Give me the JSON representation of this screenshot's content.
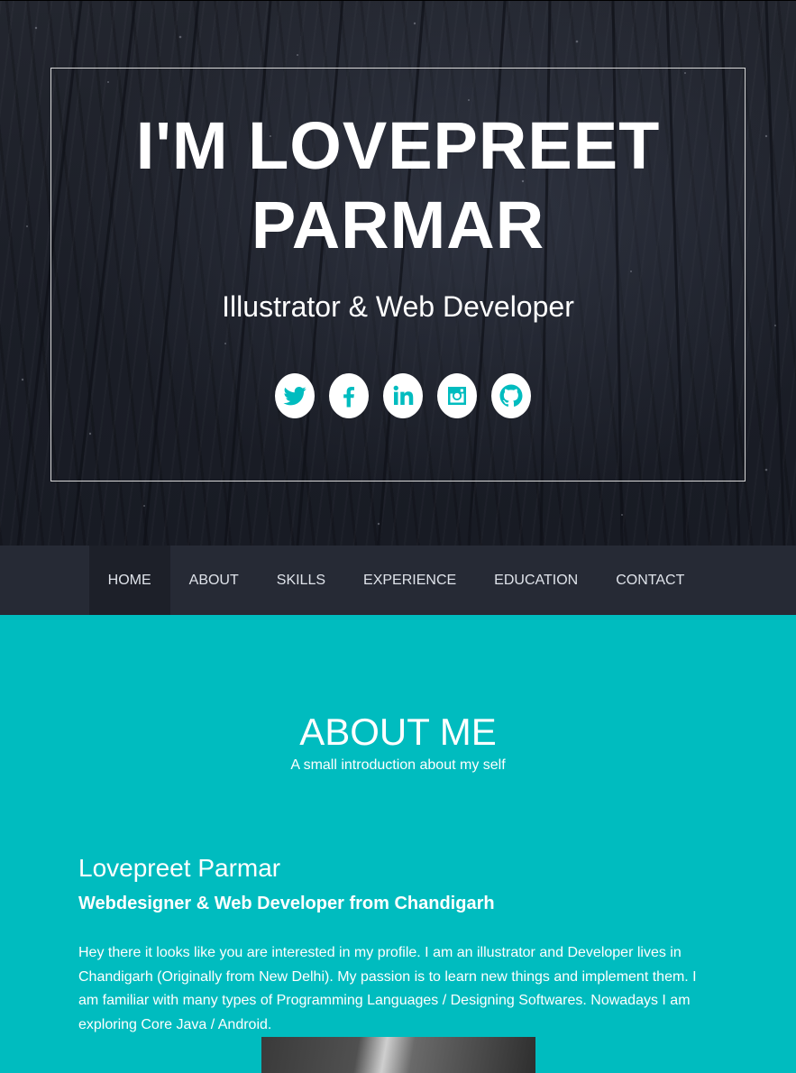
{
  "hero": {
    "name_line1": "I'M LOVEPREET",
    "name_line2": "PARMAR",
    "role": "Illustrator & Web Developer",
    "social": [
      {
        "icon": "twitter-icon"
      },
      {
        "icon": "facebook-icon"
      },
      {
        "icon": "linkedin-icon"
      },
      {
        "icon": "instagram-icon"
      },
      {
        "icon": "github-icon"
      }
    ]
  },
  "nav": {
    "items": [
      "HOME",
      "ABOUT",
      "SKILLS",
      "EXPERIENCE",
      "EDUCATION",
      "CONTACT"
    ],
    "active": "HOME"
  },
  "about": {
    "title": "ABOUT ME",
    "subtitle": "A small introduction about my self",
    "name": "Lovepreet Parmar",
    "role": "Webdesigner & Web Developer from Chandigarh",
    "bio": "Hey there it looks like you are interested in my profile. I am an illustrator and Developer lives in Chandigarh (Originally from New Delhi). My passion is to learn new things and implement them. I am familiar with many types of Programming Languages / Designing Softwares. Nowadays I am exploring Core Java / Android."
  },
  "colors": {
    "accent": "#00bcbf",
    "nav_bg": "#262a35",
    "nav_active_bg": "#1d2029",
    "hero_bg": "#1b1e27"
  }
}
